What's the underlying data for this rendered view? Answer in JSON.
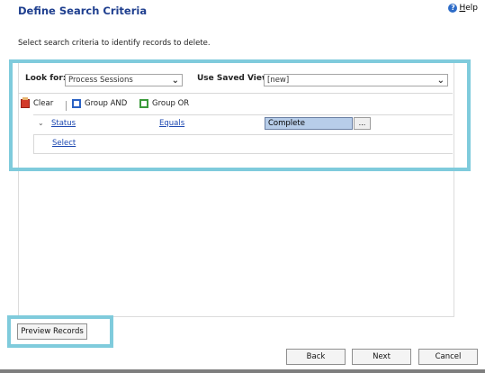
{
  "dialog": {
    "title": "Define Search Criteria",
    "help_label": "Help",
    "instruction": "Select search criteria to identify records to delete."
  },
  "query": {
    "look_for_label": "Look for:",
    "look_for_value": "Process Sessions",
    "saved_view_label": "Use Saved View:",
    "saved_view_value": "[new]"
  },
  "toolbar": {
    "clear_label": "Clear",
    "group_and_label": "Group AND",
    "group_or_label": "Group OR"
  },
  "criteria": {
    "field": "Status",
    "operator": "Equals",
    "value": "Complete",
    "lookup_button": "...",
    "add_row_link": "Select"
  },
  "footer": {
    "preview_label": "Preview Records",
    "back_label": "Back",
    "next_label": "Next",
    "cancel_label": "Cancel"
  },
  "colors": {
    "highlight": "#7fcbdc",
    "title": "#1f3f8f",
    "link": "#1c47b0",
    "selected_value_bg": "#b7cde9"
  }
}
